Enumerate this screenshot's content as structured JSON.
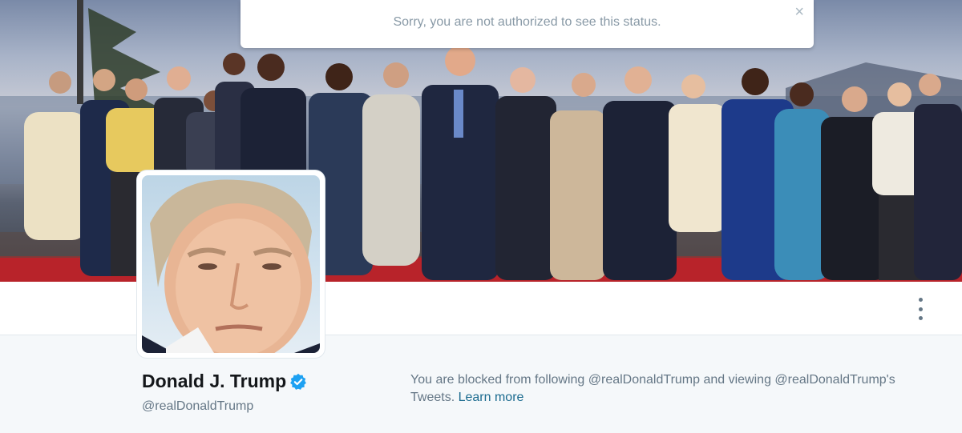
{
  "alert": {
    "message": "Sorry, you are not authorized to see this status.",
    "close_glyph": "×"
  },
  "profile": {
    "name": "Donald J. Trump",
    "handle": "@realDonaldTrump",
    "verified_icon": "verified-badge-icon",
    "more_icon": "more-vertical-icon"
  },
  "blocked": {
    "message": "You are blocked from following @realDonaldTrump and viewing @realDonaldTrump's Tweets.",
    "learn_more": "Learn more"
  },
  "colors": {
    "accent": "#1da1f2",
    "link": "#1b6b8f",
    "muted": "#657786",
    "background": "#f5f8fa"
  }
}
